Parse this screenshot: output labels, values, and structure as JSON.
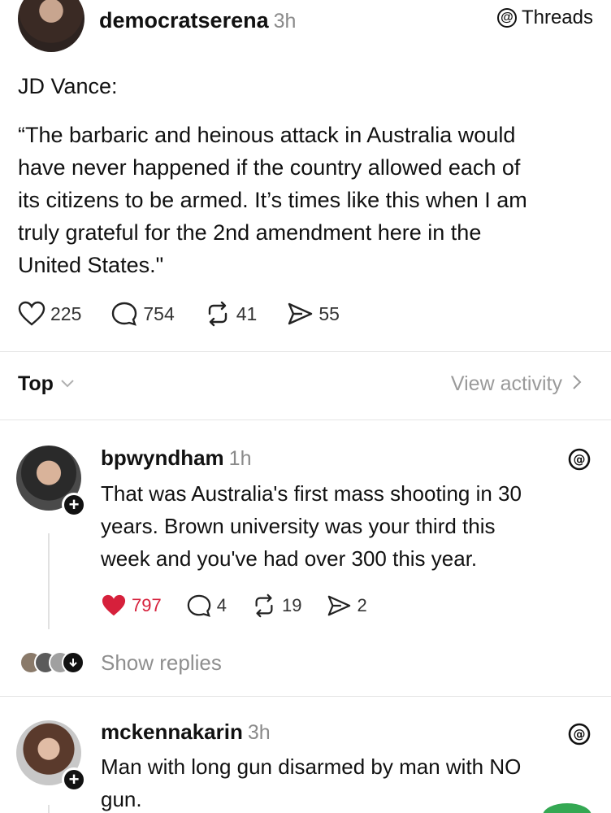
{
  "post": {
    "username": "democratserena",
    "time": "3h",
    "platform_label": "Threads",
    "author_line": "JD Vance:",
    "quote_lines": [
      "“The barbaric and heinous attack in Australia would",
      "have never happened if the country allowed each of",
      "its citizens to be armed. It’s times like this when I am",
      "truly grateful for the 2nd amendment here in the",
      "United States.\""
    ],
    "likes": "225",
    "comments": "754",
    "reposts": "41",
    "shares": "55"
  },
  "sort": {
    "label": "Top",
    "view_activity": "View activity"
  },
  "replies": [
    {
      "username": "bpwyndham",
      "time": "1h",
      "lines": [
        "That was Australia's first mass shooting in 30",
        "years. Brown university was your third this",
        "week and you've had over 300 this year."
      ],
      "likes": "797",
      "comments": "4",
      "reposts": "19",
      "shares": "2",
      "show_replies": "Show replies"
    },
    {
      "username": "mckennakarin",
      "time": "3h",
      "lines": [
        "Man with long gun disarmed by man with NO",
        "gun."
      ]
    }
  ],
  "colors": {
    "liked": "#d6203b",
    "muted": "#8f8f8f",
    "divider": "#e5e5e5"
  }
}
